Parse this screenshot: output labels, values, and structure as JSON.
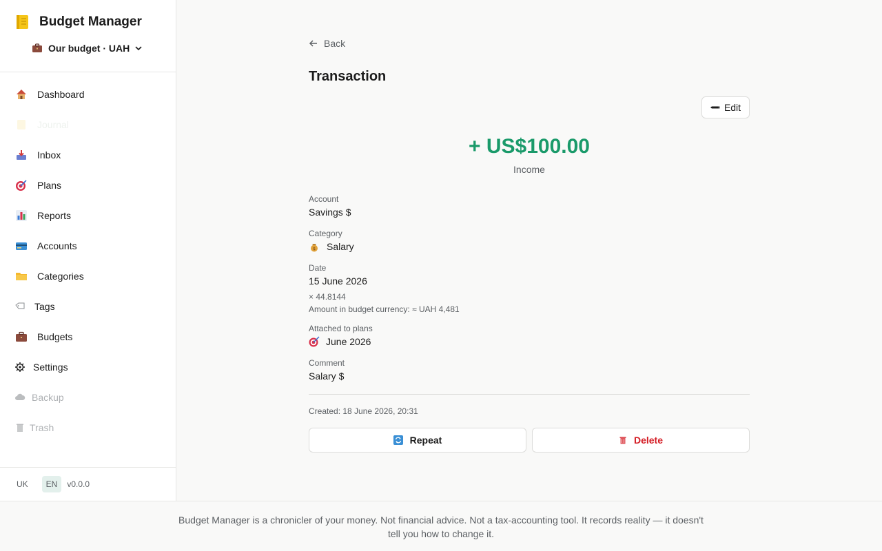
{
  "sidebar": {
    "brand_title": "Budget Manager",
    "budget_selector": "Our budget · UAH",
    "items": [
      {
        "label": "Dashboard",
        "icon": "house-icon"
      },
      {
        "label": "Journal",
        "icon": "notebook-icon"
      },
      {
        "label": "Inbox",
        "icon": "inbox-tray-icon"
      },
      {
        "label": "Plans",
        "icon": "target-icon"
      },
      {
        "label": "Reports",
        "icon": "bar-chart-icon"
      },
      {
        "label": "Accounts",
        "icon": "credit-card-icon"
      },
      {
        "label": "Categories",
        "icon": "folder-icon"
      },
      {
        "label": "Tags",
        "icon": "tag-icon"
      },
      {
        "label": "Budgets",
        "icon": "briefcase-icon"
      },
      {
        "label": "Settings",
        "icon": "gear-icon"
      },
      {
        "label": "Backup",
        "icon": "cloud-icon"
      },
      {
        "label": "Trash",
        "icon": "trash-icon"
      }
    ],
    "lang_uk": "UK",
    "lang_en": "EN",
    "version": "v0.0.0"
  },
  "main": {
    "back_label": "Back",
    "title": "Transaction",
    "edit_label": "Edit",
    "amount": "+ US$100.00",
    "amount_type": "Income",
    "account_label": "Account",
    "account_value": "Savings $",
    "category_label": "Category",
    "category_value": "Salary",
    "date_label": "Date",
    "date_value": "15 June 2026",
    "rate_note": "× 44.8144",
    "budget_currency_note": "Amount in budget currency: ≈ UAH 4,481",
    "plans_label": "Attached to plans",
    "plans_value": "June 2026",
    "comment_label": "Comment",
    "comment_value": "Salary $",
    "created": "Created: 18 June 2026, 20:31",
    "repeat_label": "Repeat",
    "delete_label": "Delete"
  },
  "footer": {
    "disclaimer": "Budget Manager is a chronicler of your money. Not financial advice. Not a tax-accounting tool. It records reality — it doesn't tell you how to change it."
  },
  "colors": {
    "income_green": "#1a9a6a",
    "delete_red": "#d41c24",
    "active_lang_bg": "#e3f0ec"
  }
}
